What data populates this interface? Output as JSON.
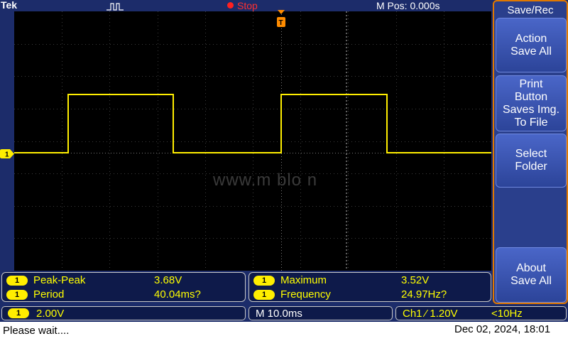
{
  "top": {
    "brand": "Tek",
    "trigger_mode_icon": "pulse-icon",
    "run_status": "Stop",
    "m_pos": "M Pos: 0.000s"
  },
  "menu": {
    "title": "Save/Rec",
    "buttons": [
      {
        "label": "Action\nSave All"
      },
      {
        "label": "Print\nButton\nSaves Img.\nTo File"
      },
      {
        "label": "Select\nFolder"
      },
      {
        "label": "About\nSave All"
      }
    ]
  },
  "waveform": {
    "channel_marker": "1",
    "watermark": "www.m  blo  n"
  },
  "measurements": {
    "left": [
      {
        "channel": "1",
        "label": "Peak-Peak",
        "value": "3.68V"
      },
      {
        "channel": "1",
        "label": "Period",
        "value": "40.04ms?"
      }
    ],
    "right": [
      {
        "channel": "1",
        "label": "Maximum",
        "value": "3.52V"
      },
      {
        "channel": "1",
        "label": "Frequency",
        "value": "24.97Hz?"
      }
    ]
  },
  "status": {
    "ch1_badge": "1",
    "ch1_scale": "2.00V",
    "timebase": "M 10.0ms",
    "trigger": "Ch1 ⁄ 1.20V",
    "trigger_freq": "<10Hz"
  },
  "footer": {
    "message": "Please wait....",
    "datetime": "Dec 02, 2024, 18:01"
  },
  "colors": {
    "trace": "#ffee00",
    "background": "#1c2c6a",
    "screen": "#000000",
    "menu_border": "#e07800"
  }
}
